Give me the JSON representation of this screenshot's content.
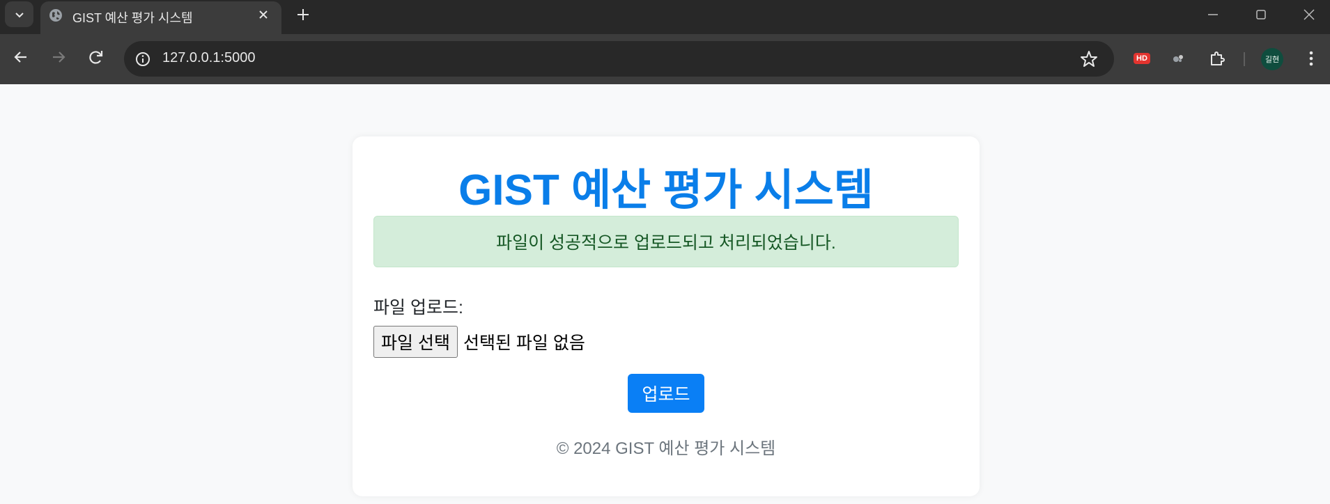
{
  "browser": {
    "tab_title": "GIST 예산 평가 시스템",
    "url": "127.0.0.1:5000",
    "extension_badge": "HD",
    "profile_initials": "길현"
  },
  "page": {
    "title": "GIST 예산 평가 시스템",
    "alert_message": "파일이 성공적으로 업로드되고 처리되었습니다.",
    "upload_label": "파일 업로드:",
    "file_button_label": "파일 선택",
    "file_status": "선택된 파일 없음",
    "submit_label": "업로드",
    "footer": "© 2024 GIST 예산 평가 시스템"
  },
  "colors": {
    "title": "#0a7ee9",
    "alert_bg": "#d4edda",
    "alert_text": "#155724",
    "button_bg": "#0a7ff5",
    "page_bg": "#f8f9fa"
  }
}
